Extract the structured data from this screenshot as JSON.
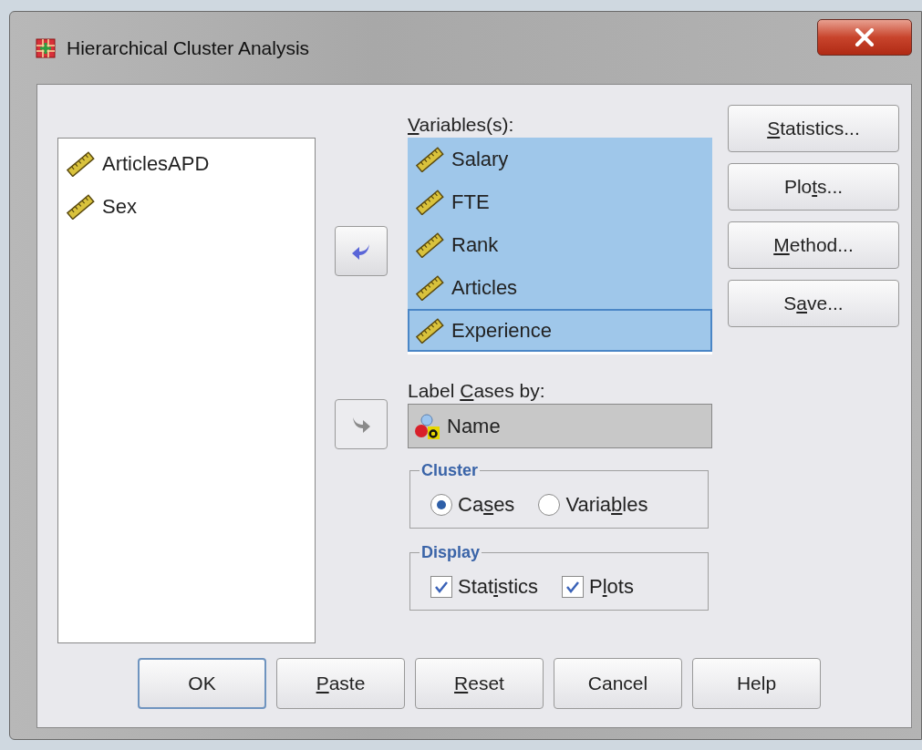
{
  "window": {
    "title": "Hierarchical Cluster Analysis"
  },
  "source_list": {
    "items": [
      {
        "name": "ArticlesAPD",
        "kind": "scale"
      },
      {
        "name": "Sex",
        "kind": "scale"
      }
    ]
  },
  "move_buttons": [
    {
      "kind": "remove",
      "disabled": false
    },
    {
      "kind": "add",
      "disabled": true
    }
  ],
  "variables": {
    "label": {
      "key": "V",
      "after": "ariables(s):"
    },
    "items": [
      {
        "name": "Salary",
        "kind": "scale",
        "selected": true,
        "focused": false
      },
      {
        "name": "FTE",
        "kind": "scale",
        "selected": true,
        "focused": false
      },
      {
        "name": "Rank",
        "kind": "scale",
        "selected": true,
        "focused": false
      },
      {
        "name": "Articles",
        "kind": "scale",
        "selected": true,
        "focused": false
      },
      {
        "name": "Experience",
        "kind": "scale",
        "selected": true,
        "focused": true
      }
    ]
  },
  "label_cases": {
    "label": {
      "before": "Label ",
      "key": "C",
      "after": "ases by:"
    },
    "value": {
      "name": "Name",
      "kind": "nominal"
    }
  },
  "cluster": {
    "title": "Cluster",
    "options": [
      {
        "label": {
          "before": "Ca",
          "key": "s",
          "after": "es"
        },
        "selected": true
      },
      {
        "label": {
          "before": "Varia",
          "key": "b",
          "after": "les"
        },
        "selected": false
      }
    ]
  },
  "display": {
    "title": "Display",
    "options": [
      {
        "label": {
          "before": "Stat",
          "key": "i",
          "after": "stics"
        },
        "checked": true
      },
      {
        "label": {
          "before": "P",
          "key": "l",
          "after": "ots"
        },
        "checked": true
      }
    ]
  },
  "side_buttons": [
    {
      "label": {
        "key": "S",
        "after": "tatistics..."
      }
    },
    {
      "label": {
        "before": "Plo",
        "key": "t",
        "after": "s..."
      }
    },
    {
      "label": {
        "key": "M",
        "after": "ethod..."
      }
    },
    {
      "label": {
        "before": "S",
        "key": "a",
        "after": "ve..."
      }
    }
  ],
  "footer_buttons": [
    {
      "label": {
        "before": "OK"
      },
      "default": true
    },
    {
      "label": {
        "key": "P",
        "after": "aste"
      },
      "default": false
    },
    {
      "label": {
        "key": "R",
        "after": "eset"
      },
      "default": false
    },
    {
      "label": {
        "before": "Cancel"
      },
      "default": false
    },
    {
      "label": {
        "before": "Help"
      },
      "default": false
    }
  ]
}
